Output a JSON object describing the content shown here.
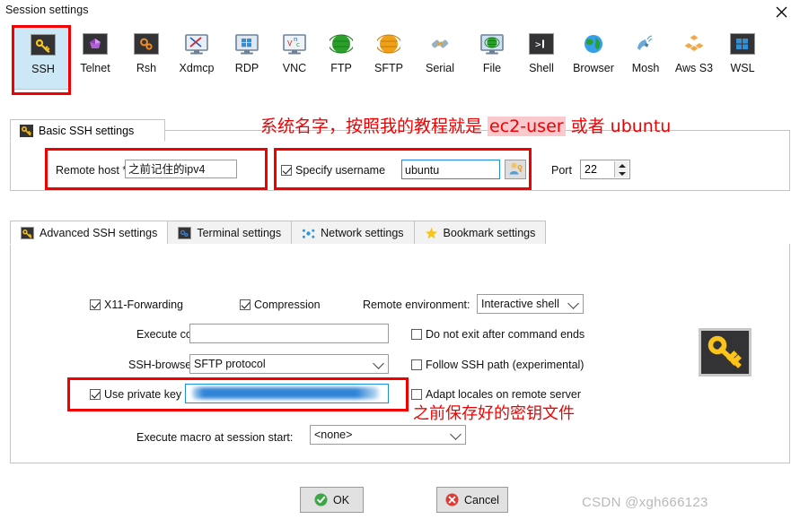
{
  "window": {
    "title": "Session settings",
    "close_icon": "close-x-icon"
  },
  "protocols": [
    {
      "id": "ssh",
      "label": "SSH",
      "icon": "ssh-key-icon",
      "selected": true
    },
    {
      "id": "telnet",
      "label": "Telnet",
      "icon": "telnet-gem-icon",
      "selected": false
    },
    {
      "id": "rsh",
      "label": "Rsh",
      "icon": "rsh-gears-icon",
      "selected": false
    },
    {
      "id": "xdmcp",
      "label": "Xdmcp",
      "icon": "xdmcp-monitor-icon",
      "selected": false
    },
    {
      "id": "rdp",
      "label": "RDP",
      "icon": "rdp-windows-icon",
      "selected": false
    },
    {
      "id": "vnc",
      "label": "VNC",
      "icon": "vnc-monitor-icon",
      "selected": false
    },
    {
      "id": "ftp",
      "label": "FTP",
      "icon": "ftp-globe-icon",
      "selected": false
    },
    {
      "id": "sftp",
      "label": "SFTP",
      "icon": "sftp-globe-icon",
      "selected": false
    },
    {
      "id": "serial",
      "label": "Serial",
      "icon": "serial-plug-icon",
      "selected": false
    },
    {
      "id": "file",
      "label": "File",
      "icon": "file-monitor-icon",
      "selected": false
    },
    {
      "id": "shell",
      "label": "Shell",
      "icon": "shell-prompt-icon",
      "selected": false
    },
    {
      "id": "browser",
      "label": "Browser",
      "icon": "browser-globe-icon",
      "selected": false
    },
    {
      "id": "mosh",
      "label": "Mosh",
      "icon": "mosh-dish-icon",
      "selected": false
    },
    {
      "id": "awss3",
      "label": "Aws S3",
      "icon": "aws-s3-boxes-icon",
      "selected": false
    },
    {
      "id": "wsl",
      "label": "WSL",
      "icon": "wsl-windows-icon",
      "selected": false
    }
  ],
  "basic": {
    "tab_label": "Basic SSH settings",
    "tab_icon": "ssh-key-icon",
    "remote_host_label": "Remote host *",
    "remote_host_value": "之前记住的ipv4",
    "specify_username_label": "Specify username",
    "specify_username_checked": true,
    "username_value": "ubuntu",
    "user_button_icon": "user-key-icon",
    "port_label": "Port",
    "port_value": "22"
  },
  "tabs": [
    {
      "id": "advanced",
      "label": "Advanced SSH settings",
      "icon": "ssh-key-icon",
      "active": true
    },
    {
      "id": "terminal",
      "label": "Terminal settings",
      "icon": "terminal-gear-icon",
      "active": false
    },
    {
      "id": "network",
      "label": "Network settings",
      "icon": "network-dots-icon",
      "active": false
    },
    {
      "id": "bookmark",
      "label": "Bookmark settings",
      "icon": "star-icon",
      "active": false
    }
  ],
  "advanced": {
    "x11_label": "X11-Forwarding",
    "x11_checked": true,
    "compression_label": "Compression",
    "compression_checked": true,
    "remote_env_label": "Remote environment:",
    "remote_env_value": "Interactive shell",
    "execute_command_label": "Execute command:",
    "execute_command_value": "",
    "do_not_exit_label": "Do not exit after command ends",
    "do_not_exit_checked": false,
    "ssh_browser_label": "SSH-browser type:",
    "ssh_browser_value": "SFTP protocol",
    "follow_ssh_path_label": "Follow SSH path (experimental)",
    "follow_ssh_path_checked": false,
    "use_private_key_label": "Use private key",
    "use_private_key_checked": true,
    "private_key_value": "",
    "adapt_locales_label": "Adapt locales on remote server",
    "adapt_locales_checked": false,
    "macro_label": "Execute macro at session start:",
    "macro_value": "<none>",
    "key_image_icon": "big-key-icon"
  },
  "footer": {
    "ok_label": "OK",
    "ok_icon": "green-check-icon",
    "cancel_label": "Cancel",
    "cancel_icon": "red-x-icon"
  },
  "annotations": {
    "username_note_prefix": "系统名字，按照我的教程就是 ",
    "username_note_highlight": "ec2-user",
    "username_note_suffix": " 或者 ubuntu",
    "private_key_note": "之前保存好的密钥文件"
  },
  "watermark": {
    "url": "https://blog.csdn.net/xgh666123",
    "text": "CSDN @xgh666123"
  }
}
